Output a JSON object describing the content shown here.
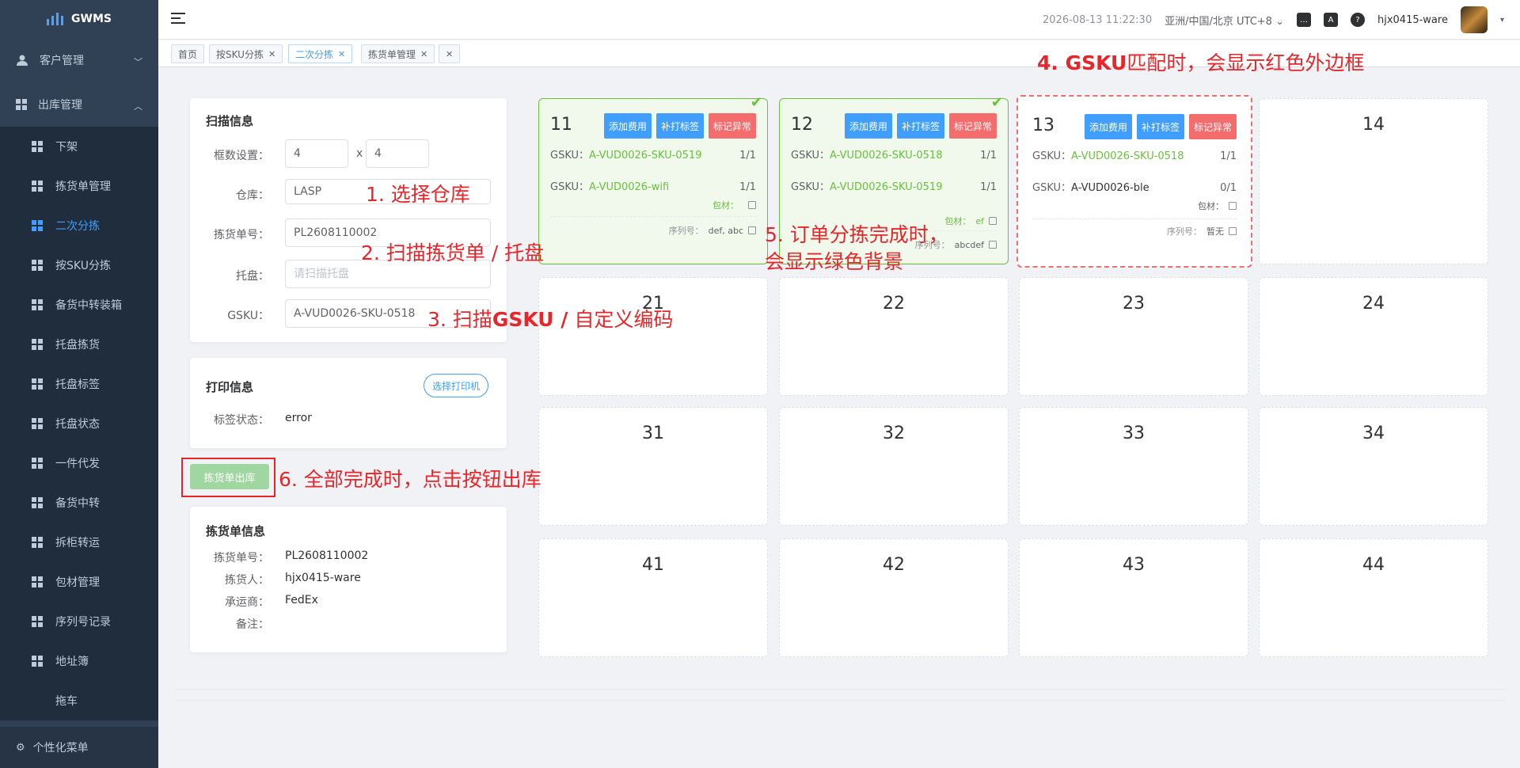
{
  "sidebar": {
    "logo_text": "GWMS",
    "groups": [
      {
        "label": "客户管理",
        "icon": "user-icon"
      },
      {
        "label": "出库管理",
        "icon": "grid-icon"
      }
    ],
    "items": [
      {
        "label": "下架"
      },
      {
        "label": "拣货单管理"
      },
      {
        "label": "二次分拣",
        "active": true
      },
      {
        "label": "按SKU分拣"
      },
      {
        "label": "备货中转装箱"
      },
      {
        "label": "托盘拣货"
      },
      {
        "label": "托盘标签"
      },
      {
        "label": "托盘状态"
      },
      {
        "label": "一件代发"
      },
      {
        "label": "备货中转"
      },
      {
        "label": "拆柜转运"
      },
      {
        "label": "包材管理"
      },
      {
        "label": "序列号记录"
      },
      {
        "label": "地址簿"
      },
      {
        "label": "拖车"
      }
    ],
    "footer_label": "个性化菜单"
  },
  "header": {
    "datetime": "2026-08-13 11:22:30",
    "timezone": "亚洲/中国/北京 UTC+8",
    "username": "hjx0415-ware"
  },
  "tabs": [
    {
      "label": "首页"
    },
    {
      "label": "按SKU分拣"
    },
    {
      "label": "二次分拣",
      "active": true
    },
    {
      "label": "拣货单管理"
    },
    {
      "label": ""
    }
  ],
  "scan": {
    "title": "扫描信息",
    "box_count_label": "框数设置：",
    "rows_value": "4",
    "times": "x",
    "cols_value": "4",
    "warehouse_label": "仓库：",
    "warehouse_value": "LASP",
    "picklist_label": "拣货单号：",
    "picklist_value": "PL2608110002",
    "pallet_label": "托盘：",
    "pallet_placeholder": "请扫描托盘",
    "gsku_label": "GSKU：",
    "gsku_value": "A-VUD0026-SKU-0518"
  },
  "print": {
    "title": "打印信息",
    "select_printer": "选择打印机",
    "status_label": "标签状态：",
    "status_value": "error"
  },
  "ship_button": "拣货单出库",
  "picklist_info": {
    "title": "拣货单信息",
    "no_label": "拣货单号：",
    "no_value": "PL2608110002",
    "picker_label": "拣货人：",
    "picker_value": "hjx0415-ware",
    "carrier_label": "承运商：",
    "carrier_value": "FedEx",
    "remark_label": "备注："
  },
  "box_actions": {
    "add_fee": "添加费用",
    "reprint": "补打标签",
    "mark_error": "标记异常"
  },
  "box_labels": {
    "gsku": "GSKU：",
    "material": "包材：",
    "serial": "序列号："
  },
  "boxes": {
    "b11": {
      "num": "11",
      "l1": "A-VUD0026-SKU-0519",
      "q1": "1/1",
      "l2": "A-VUD0026-wifi",
      "q2": "1/1",
      "material": "",
      "serial": "def, abc"
    },
    "b12": {
      "num": "12",
      "l1": "A-VUD0026-SKU-0518",
      "q1": "1/1",
      "l2": "A-VUD0026-SKU-0519",
      "q2": "1/1",
      "material": "ef",
      "serial": "abcdef"
    },
    "b13": {
      "num": "13",
      "l1": "A-VUD0026-SKU-0518",
      "q1": "1/1",
      "l2": "A-VUD0026-ble",
      "q2": "0/1",
      "material": "",
      "serial": "暂无"
    },
    "others": [
      "14",
      "21",
      "22",
      "23",
      "24",
      "31",
      "32",
      "33",
      "34",
      "41",
      "42",
      "43",
      "44"
    ]
  },
  "annotations": {
    "a1": "1. 选择仓库",
    "a2": "2. 扫描拣货单 / 托盘",
    "a3_pre": "3. 扫描",
    "a3_bold": "GSKU /",
    "a3_post": " 自定义编码",
    "a4_bold": "4. GSKU",
    "a4_post": "匹配时，会显示红色外边框",
    "a5_l1": "5. 订单分拣完成时，",
    "a5_l2": "会显示绿色背景",
    "a6": "6. 全部完成时，点击按钮出库"
  },
  "colors": {
    "sidebar": "#304156",
    "accent": "#409eff",
    "success": "#67c23a",
    "danger": "#f56c6c",
    "annotation": "#e8262a"
  }
}
